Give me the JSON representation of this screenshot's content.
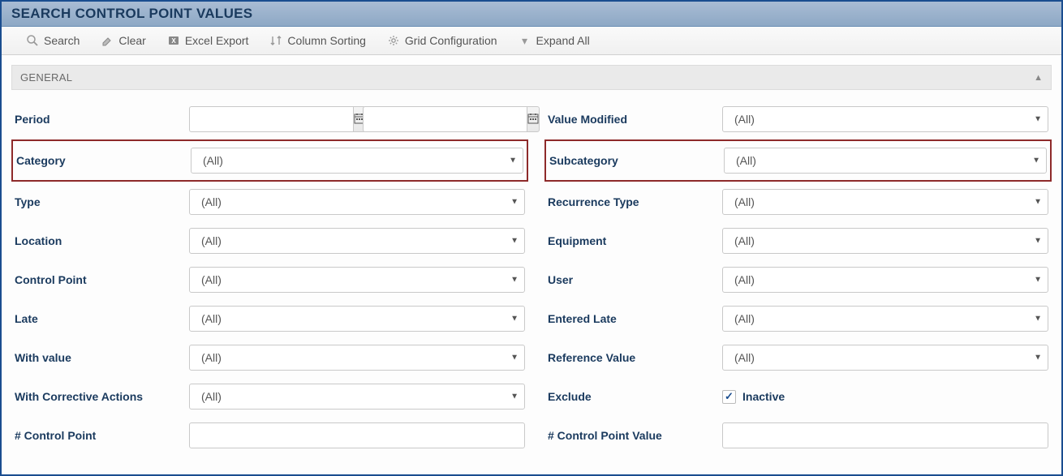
{
  "title": "SEARCH CONTROL POINT VALUES",
  "toolbar": {
    "search": "Search",
    "clear": "Clear",
    "excel_export": "Excel Export",
    "column_sorting": "Column Sorting",
    "grid_config": "Grid Configuration",
    "expand_all": "Expand All"
  },
  "section": {
    "general": "GENERAL"
  },
  "fields": {
    "period": {
      "label": "Period",
      "from": "",
      "to": ""
    },
    "value_modified": {
      "label": "Value Modified",
      "value": "(All)"
    },
    "category": {
      "label": "Category",
      "value": "(All)"
    },
    "subcategory": {
      "label": "Subcategory",
      "value": "(All)"
    },
    "type": {
      "label": "Type",
      "value": "(All)"
    },
    "recurrence_type": {
      "label": "Recurrence Type",
      "value": "(All)"
    },
    "location": {
      "label": "Location",
      "value": "(All)"
    },
    "equipment": {
      "label": "Equipment",
      "value": "(All)"
    },
    "control_point": {
      "label": "Control Point",
      "value": "(All)"
    },
    "user": {
      "label": "User",
      "value": "(All)"
    },
    "late": {
      "label": "Late",
      "value": "(All)"
    },
    "entered_late": {
      "label": "Entered Late",
      "value": "(All)"
    },
    "with_value": {
      "label": "With value",
      "value": "(All)"
    },
    "reference_value": {
      "label": "Reference Value",
      "value": "(All)"
    },
    "with_corrective": {
      "label": "With Corrective Actions",
      "value": "(All)"
    },
    "exclude": {
      "label": "Exclude",
      "inactive_label": "Inactive",
      "inactive_checked": true
    },
    "num_control_point": {
      "label": "# Control Point",
      "value": ""
    },
    "num_control_point_value": {
      "label": "# Control Point Value",
      "value": ""
    }
  }
}
